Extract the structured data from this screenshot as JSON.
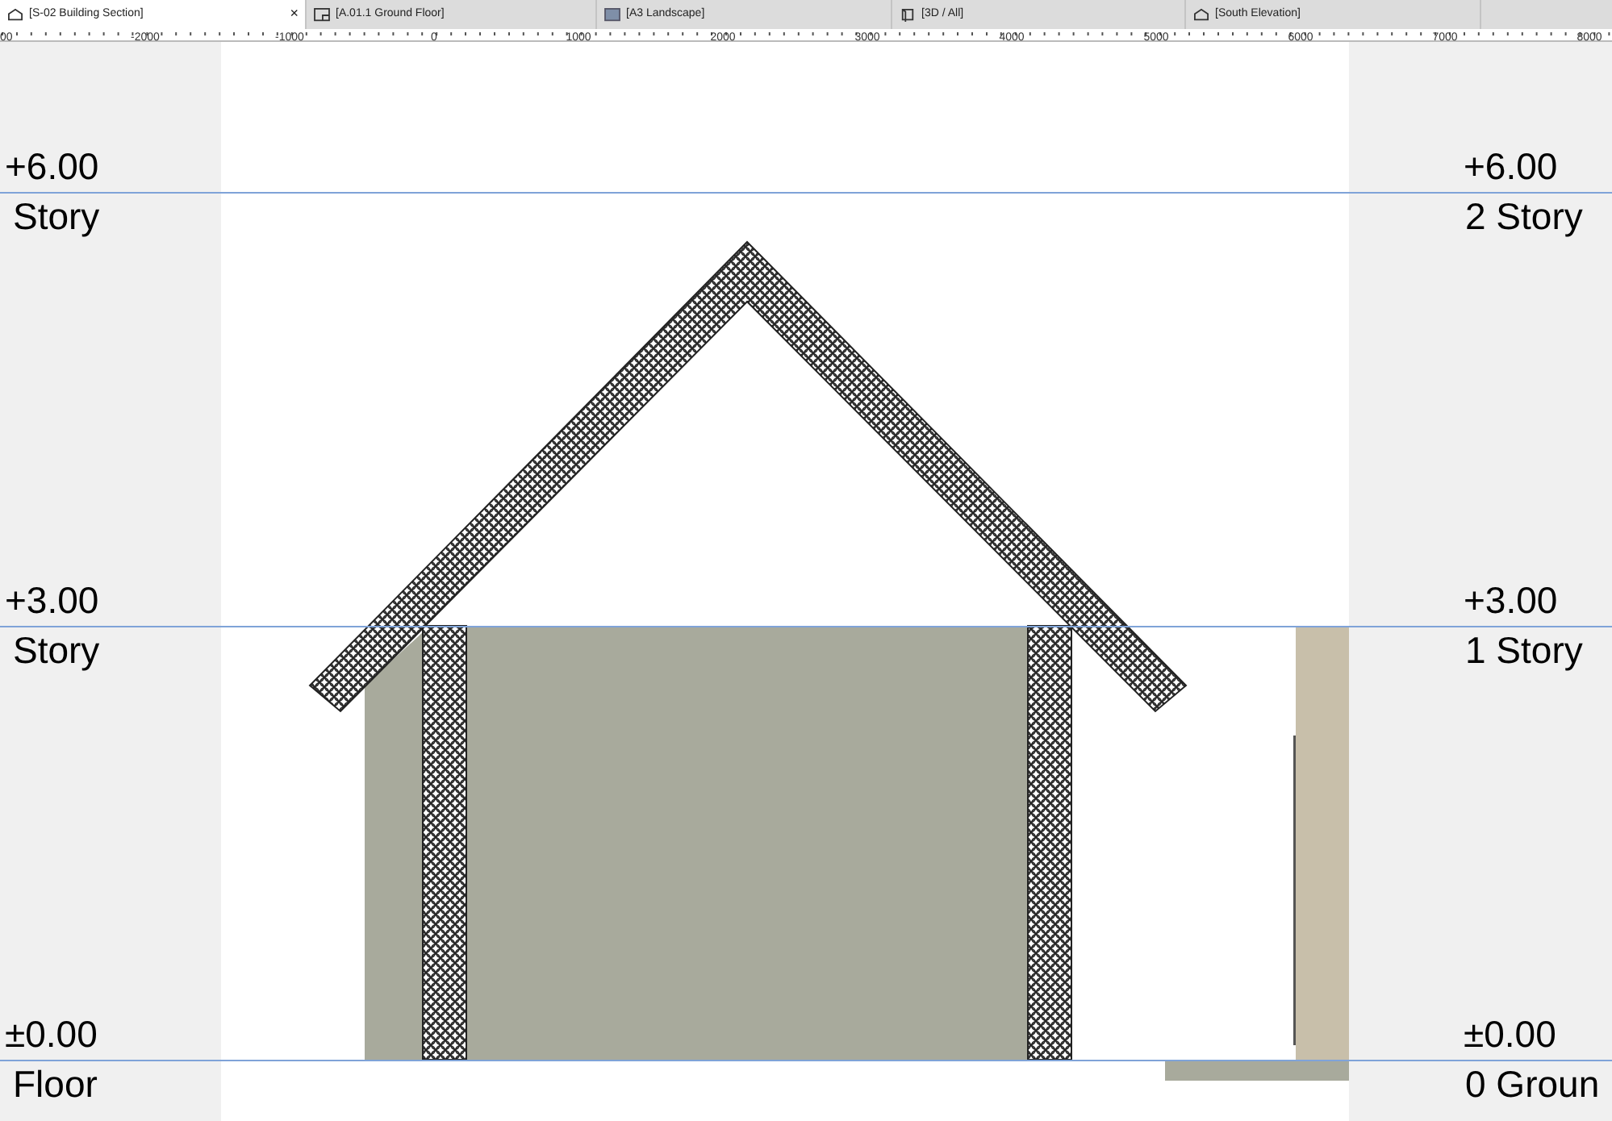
{
  "tabs": [
    {
      "label": "[S-02 Building Section]",
      "kind": "section",
      "selected": true,
      "close": "×"
    },
    {
      "label": "[A.01.1 Ground Floor]",
      "kind": "plan",
      "selected": false
    },
    {
      "label": "[A3 Landscape]",
      "kind": "layout",
      "selected": false
    },
    {
      "label": "[3D / All]",
      "kind": "model",
      "selected": false
    },
    {
      "label": "[South Elevation]",
      "kind": "elevation",
      "selected": false
    }
  ],
  "ruler": {
    "labels": [
      "00",
      "-2000",
      "-1000",
      "0",
      "1000",
      "2000",
      "3000",
      "4000",
      "5000",
      "6000",
      "7000",
      "8000"
    ]
  },
  "stories": [
    {
      "elevation_left": "+6.00",
      "name_left": "Story",
      "elevation_right": "+6.00",
      "name_right": "2 Story"
    },
    {
      "elevation_left": "+3.00",
      "name_left": "Story",
      "elevation_right": "+3.00",
      "name_right": "1 Story"
    },
    {
      "elevation_left": "±0.00",
      "name_left": "Floor",
      "elevation_right": "±0.00",
      "name_right": "0 Groun"
    }
  ]
}
